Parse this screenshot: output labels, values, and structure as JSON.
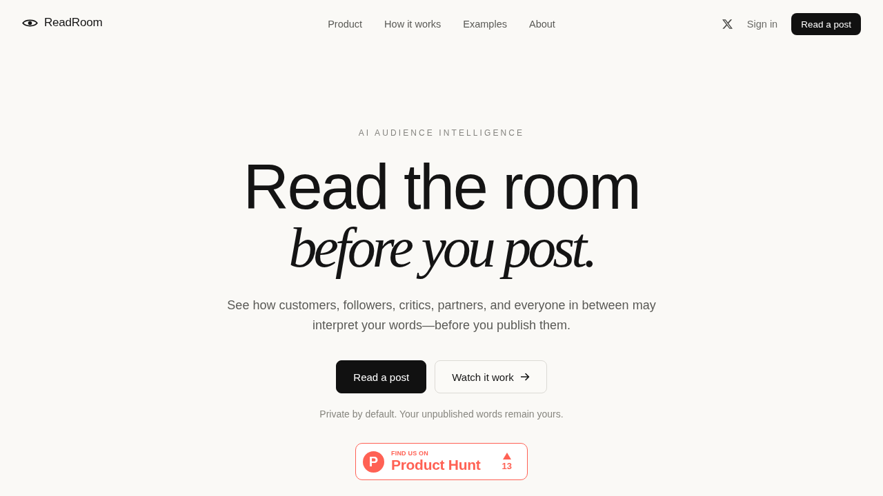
{
  "header": {
    "brand": "ReadRoom",
    "nav": [
      "Product",
      "How it works",
      "Examples",
      "About"
    ],
    "sign_in": "Sign in",
    "cta": "Read a post"
  },
  "hero": {
    "eyebrow": "AI AUDIENCE INTELLIGENCE",
    "headline": "Read the room",
    "headline_accent": "before you post.",
    "description": "See how customers, followers, critics, partners, and everyone in between may interpret your words—before you publish them.",
    "buttons": [
      {
        "label": "Read a post",
        "kind": "primary"
      },
      {
        "label": "Watch it work",
        "kind": "secondary"
      }
    ],
    "note": "Private by default. Your unpublished words remain yours.",
    "badge": {
      "logo_letter": "P",
      "eyebrow": "FIND US ON",
      "name": "Product Hunt",
      "count": "13"
    }
  }
}
